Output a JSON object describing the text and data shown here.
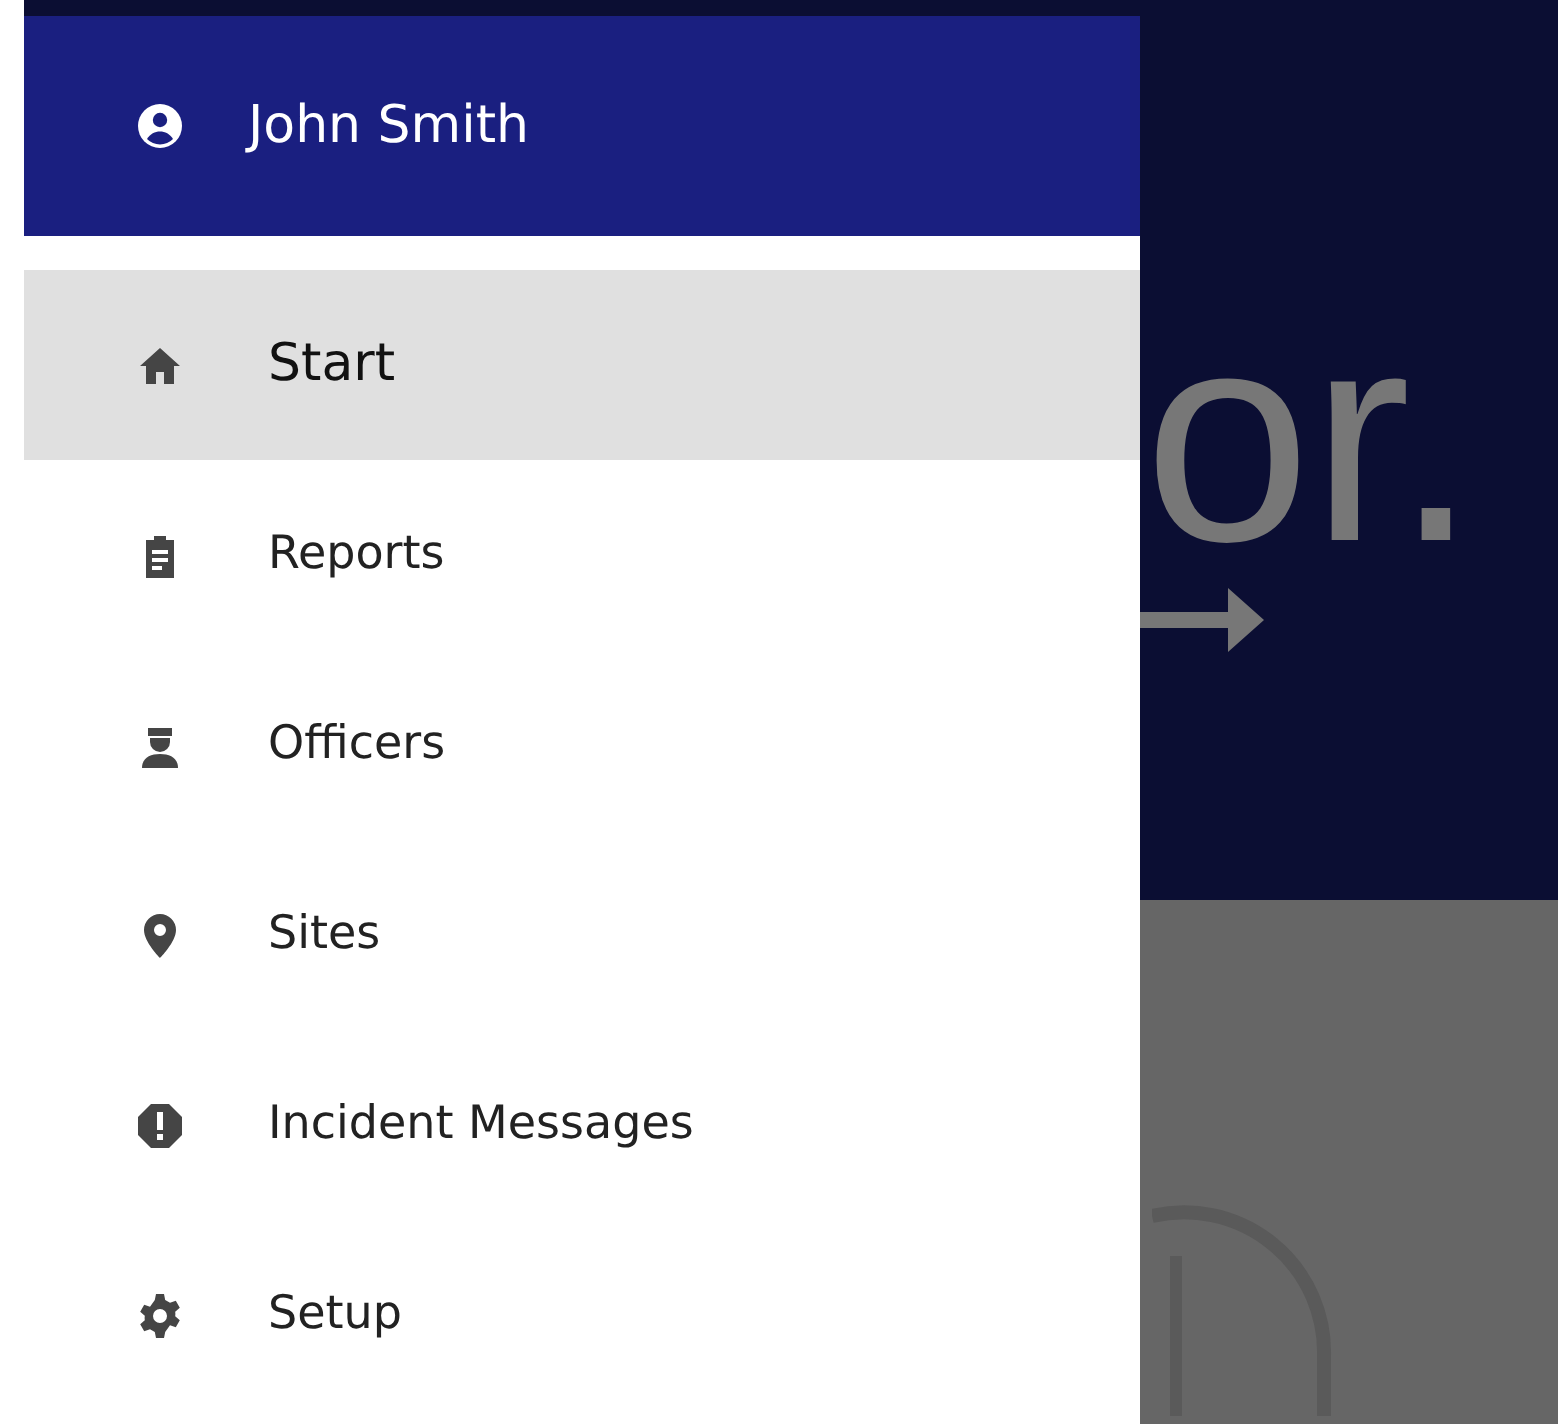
{
  "drawer": {
    "user": {
      "name": "John Smith"
    },
    "items": [
      {
        "label": "Start",
        "selected": true
      },
      {
        "label": "Reports",
        "selected": false
      },
      {
        "label": "Officers",
        "selected": false
      },
      {
        "label": "Sites",
        "selected": false
      },
      {
        "label": "Incident Messages",
        "selected": false
      },
      {
        "label": "Setup",
        "selected": false
      }
    ]
  },
  "background": {
    "logo_text": "or."
  }
}
